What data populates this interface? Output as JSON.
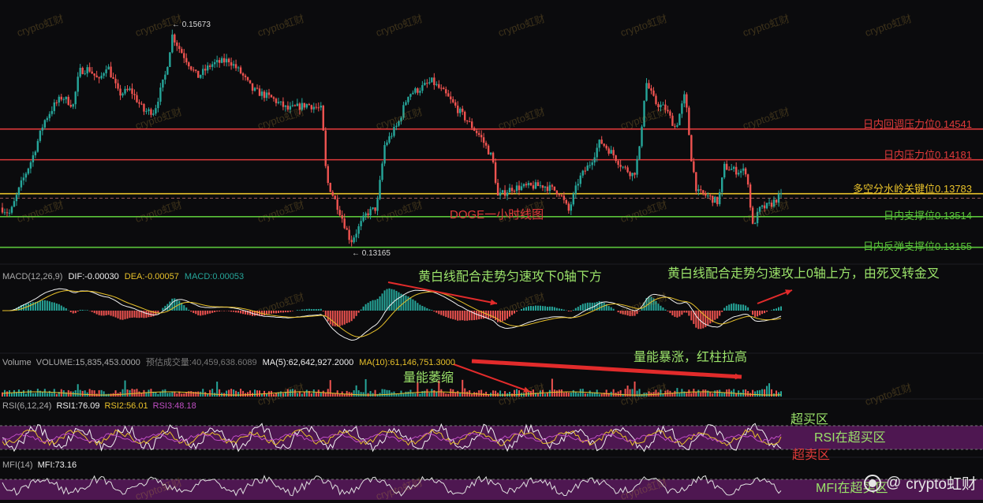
{
  "chart_data": {
    "type": "candlestick",
    "symbol_title": "DOGE一小时线图",
    "price": {
      "high_label": "0.15673",
      "low_label": "0.13165",
      "ylim": [
        0.1305,
        0.1598
      ],
      "key_points": [
        {
          "i": 0,
          "p": 0.1362
        },
        {
          "i": 12,
          "p": 0.1355
        },
        {
          "i": 25,
          "p": 0.1388
        },
        {
          "i": 40,
          "p": 0.142
        },
        {
          "i": 55,
          "p": 0.1463
        },
        {
          "i": 68,
          "p": 0.1482
        },
        {
          "i": 78,
          "p": 0.1492
        },
        {
          "i": 92,
          "p": 0.1482
        },
        {
          "i": 100,
          "p": 0.1522
        },
        {
          "i": 112,
          "p": 0.1525
        },
        {
          "i": 125,
          "p": 0.151
        },
        {
          "i": 135,
          "p": 0.153
        },
        {
          "i": 150,
          "p": 0.1495
        },
        {
          "i": 165,
          "p": 0.15
        },
        {
          "i": 182,
          "p": 0.1475
        },
        {
          "i": 195,
          "p": 0.1475
        },
        {
          "i": 210,
          "p": 0.152
        },
        {
          "i": 218,
          "p": 0.1564
        },
        {
          "i": 228,
          "p": 0.1547
        },
        {
          "i": 250,
          "p": 0.1515
        },
        {
          "i": 268,
          "p": 0.153
        },
        {
          "i": 290,
          "p": 0.1535
        },
        {
          "i": 305,
          "p": 0.152
        },
        {
          "i": 320,
          "p": 0.15
        },
        {
          "i": 345,
          "p": 0.149
        },
        {
          "i": 365,
          "p": 0.1477
        },
        {
          "i": 390,
          "p": 0.1483
        },
        {
          "i": 408,
          "p": 0.1477
        },
        {
          "i": 414,
          "p": 0.1395
        },
        {
          "i": 432,
          "p": 0.1355
        },
        {
          "i": 445,
          "p": 0.1322
        },
        {
          "i": 465,
          "p": 0.1355
        },
        {
          "i": 478,
          "p": 0.1362
        },
        {
          "i": 488,
          "p": 0.1435
        },
        {
          "i": 505,
          "p": 0.146
        },
        {
          "i": 518,
          "p": 0.1495
        },
        {
          "i": 530,
          "p": 0.15
        },
        {
          "i": 548,
          "p": 0.151
        },
        {
          "i": 565,
          "p": 0.1495
        },
        {
          "i": 590,
          "p": 0.1467
        },
        {
          "i": 610,
          "p": 0.1445
        },
        {
          "i": 625,
          "p": 0.142
        },
        {
          "i": 632,
          "p": 0.1375
        },
        {
          "i": 650,
          "p": 0.1385
        },
        {
          "i": 690,
          "p": 0.1388
        },
        {
          "i": 710,
          "p": 0.138
        },
        {
          "i": 722,
          "p": 0.1358
        },
        {
          "i": 735,
          "p": 0.1395
        },
        {
          "i": 750,
          "p": 0.1415
        },
        {
          "i": 762,
          "p": 0.144
        },
        {
          "i": 778,
          "p": 0.1425
        },
        {
          "i": 790,
          "p": 0.141
        },
        {
          "i": 805,
          "p": 0.14
        },
        {
          "i": 812,
          "p": 0.143
        },
        {
          "i": 820,
          "p": 0.151
        },
        {
          "i": 832,
          "p": 0.1485
        },
        {
          "i": 845,
          "p": 0.1478
        },
        {
          "i": 858,
          "p": 0.1455
        },
        {
          "i": 870,
          "p": 0.1495
        },
        {
          "i": 878,
          "p": 0.142
        },
        {
          "i": 885,
          "p": 0.138
        },
        {
          "i": 900,
          "p": 0.1375
        },
        {
          "i": 912,
          "p": 0.1368
        },
        {
          "i": 920,
          "p": 0.141
        },
        {
          "i": 935,
          "p": 0.1405
        },
        {
          "i": 948,
          "p": 0.1405
        },
        {
          "i": 956,
          "p": 0.134
        },
        {
          "i": 965,
          "p": 0.136
        },
        {
          "i": 978,
          "p": 0.1365
        },
        {
          "i": 990,
          "p": 0.1375
        }
      ]
    },
    "levels": [
      {
        "label": "日内回调压力位0.14541",
        "value": 0.14541,
        "color": "#e03a3a"
      },
      {
        "label": "日内压力位0.14181",
        "value": 0.14181,
        "color": "#e03a3a"
      },
      {
        "label": "多空分水岭关键位0.13783",
        "value": 0.13783,
        "color": "#e8c12a"
      },
      {
        "label": "日内支撑位0.13514",
        "value": 0.13514,
        "color": "#5ac43a"
      },
      {
        "label": "日内反弹支撑位0.13155",
        "value": 0.13155,
        "color": "#5ac43a"
      }
    ],
    "macd": {
      "name": "MACD(12,26,9)",
      "dif": "DIF:-0.00030",
      "dea": "DEA:-0.00057",
      "macd": "MACD:0.00053"
    },
    "volume": {
      "name": "Volume",
      "vol": "VOLUME:15,835,453.0000",
      "est": "预估成交量:40,459,638.6089",
      "ma5": "MA(5):62,642,927.2000",
      "ma10": "MA(10):61,146,751.3000"
    },
    "rsi": {
      "name": "RSI(6,12,24)",
      "rsi1": "RSI1:76.09",
      "rsi2": "RSI2:56.01",
      "rsi3": "RSI3:48.18"
    },
    "mfi": {
      "name": "MFI(14)",
      "mfi": "MFI:73.16"
    },
    "annotations": {
      "macd_left": "黄白线配合走势匀速攻下0轴下方",
      "macd_right": "黄白线配合走势匀速攻上0轴上方，由死叉转金叉",
      "vol_up": "量能暴涨，红柱拉高",
      "vol_down": "量能萎缩",
      "overbought": "超买区",
      "rsi_in": "RSI在超买区",
      "oversold": "超卖区",
      "mfi_in": "MFI在超买区"
    },
    "watermark": "crypto虹财",
    "colors": {
      "up": "#26a69a",
      "down": "#ef5350",
      "macd_dif": "#f0f0f0",
      "macd_dea": "#e8c12a",
      "rsi_band": "#5a1a5e"
    }
  }
}
